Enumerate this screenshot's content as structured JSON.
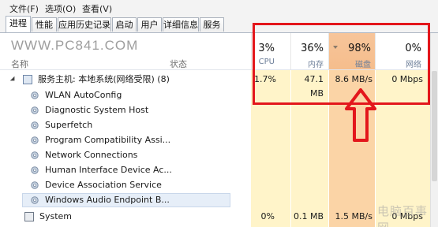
{
  "menu": {
    "items": [
      "文件(F)",
      "选项(O)",
      "查看(V)"
    ]
  },
  "tabs": [
    "进程",
    "性能",
    "应用历史记录",
    "启动",
    "用户",
    "详细信息",
    "服务"
  ],
  "watermark": "WWW.PC841.COM",
  "watermark_bottom": "电脑百事网",
  "columns": {
    "name": "名称",
    "status": "状态",
    "cpu": {
      "percent": "3%",
      "label": "CPU"
    },
    "memory": {
      "percent": "36%",
      "label": "内存"
    },
    "disk": {
      "percent": "98%",
      "label": "磁盘"
    },
    "network": {
      "percent": "0%",
      "label": "网络"
    }
  },
  "rows": [
    {
      "name": "服务主机: 本地系统(网络受限) (8)",
      "cpu": "1.7%",
      "memory": "47.1 MB",
      "disk": "8.6 MB/s",
      "network": "0 Mbps"
    },
    {
      "name": "WLAN AutoConfig",
      "cpu": "",
      "memory": "",
      "disk": "",
      "network": ""
    },
    {
      "name": "Diagnostic System Host",
      "cpu": "",
      "memory": "",
      "disk": "",
      "network": ""
    },
    {
      "name": "Superfetch",
      "cpu": "",
      "memory": "",
      "disk": "",
      "network": ""
    },
    {
      "name": "Program Compatibility Assi...",
      "cpu": "",
      "memory": "",
      "disk": "",
      "network": ""
    },
    {
      "name": "Network Connections",
      "cpu": "",
      "memory": "",
      "disk": "",
      "network": ""
    },
    {
      "name": "Human Interface Device Ac...",
      "cpu": "",
      "memory": "",
      "disk": "",
      "network": ""
    },
    {
      "name": "Device Association Service",
      "cpu": "",
      "memory": "",
      "disk": "",
      "network": ""
    },
    {
      "name": "Windows Audio Endpoint B...",
      "cpu": "",
      "memory": "",
      "disk": "",
      "network": ""
    },
    {
      "name": "System",
      "cpu": "0%",
      "memory": "0.1 MB",
      "disk": "1.5 MB/s",
      "network": "0 Mbps"
    }
  ],
  "colors": {
    "annotation": "#e3161b",
    "disk_highlight": "#fbd4a6",
    "column_highlight": "#fff4c9"
  }
}
